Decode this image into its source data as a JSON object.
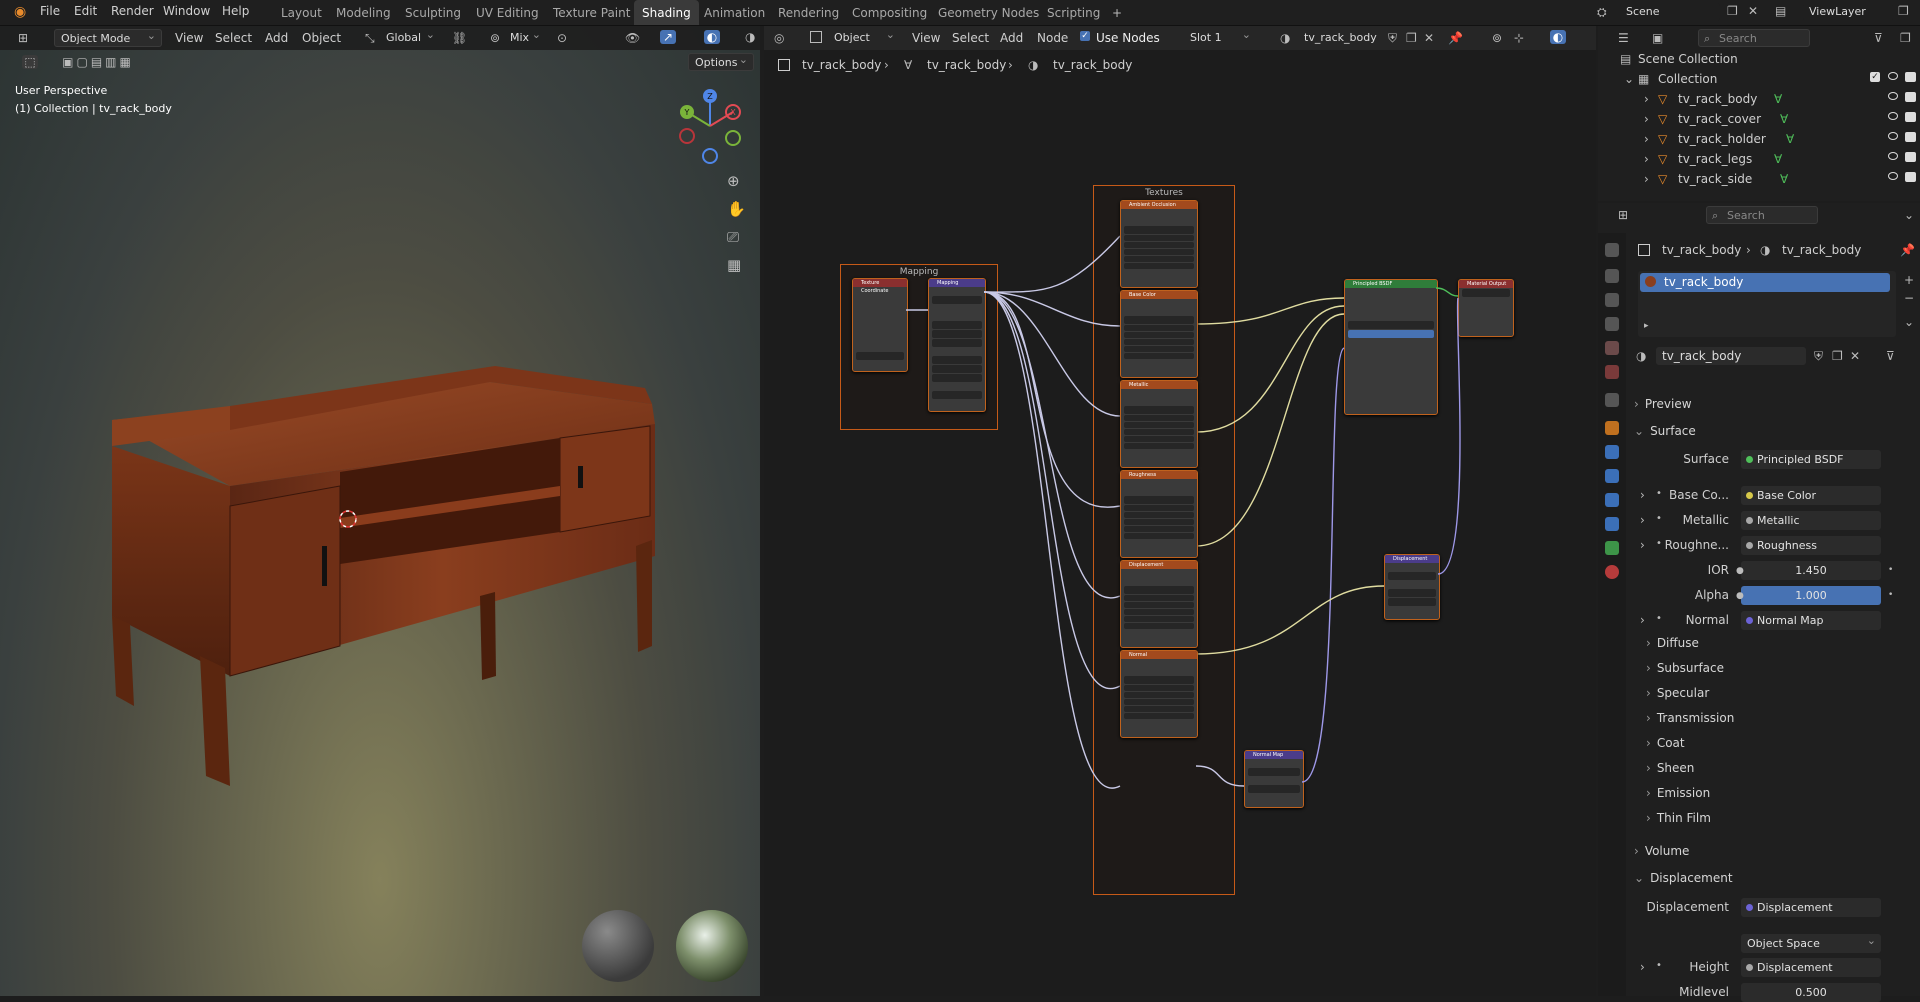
{
  "topbar": {
    "menus": [
      "File",
      "Edit",
      "Render",
      "Window",
      "Help"
    ],
    "workspaces": [
      "Layout",
      "Modeling",
      "Sculpting",
      "UV Editing",
      "Texture Paint",
      "Shading",
      "Animation",
      "Rendering",
      "Compositing",
      "Geometry Nodes",
      "Scripting"
    ],
    "active_workspace": "Shading",
    "add_tab": "+",
    "scene": "Scene",
    "view_layer": "ViewLayer"
  },
  "viewport": {
    "mode": "Object Mode",
    "menus": [
      "View",
      "Select",
      "Add",
      "Object"
    ],
    "orientation": "Global",
    "snap_mix": "Mix",
    "options": "Options",
    "overlay_title": "User Perspective",
    "overlay_collection": "(1) Collection | tv_rack_body",
    "gizmo_axes": {
      "z": "Z",
      "y": "Y",
      "x": "X"
    }
  },
  "node_editor": {
    "type": "Object",
    "menus": [
      "View",
      "Select",
      "Add",
      "Node"
    ],
    "use_nodes": "Use Nodes",
    "slot": "Slot 1",
    "material": "tv_rack_body",
    "breadcrumb": [
      "tv_rack_body",
      "tv_rack_body",
      "tv_rack_body"
    ],
    "frames": {
      "mapping": "Mapping",
      "textures": "Textures"
    },
    "nodes": {
      "tex_coord": "Texture Coordinate",
      "mapping": "Mapping",
      "ambient_occlusion": "Ambient Occlusion",
      "base_color": "Base Color",
      "metallic": "Metallic",
      "roughness": "Roughness",
      "displacement": "Displacement",
      "normal": "Normal",
      "normal_map": "Normal Map",
      "principled": "Principled BSDF",
      "displacement_node": "Displacement",
      "material_output": "Material Output"
    }
  },
  "outliner": {
    "search_placeholder": "Search",
    "scene_collection": "Scene Collection",
    "collection": "Collection",
    "objects": [
      "tv_rack_body",
      "tv_rack_cover",
      "tv_rack_holder",
      "tv_rack_legs",
      "tv_rack_side"
    ]
  },
  "properties": {
    "search_placeholder": "Search",
    "breadcrumb": [
      "tv_rack_body",
      "tv_rack_body"
    ],
    "slot_item": "tv_rack_body",
    "material_name": "tv_rack_body",
    "sections": {
      "preview": "Preview",
      "surface": "Surface",
      "volume": "Volume",
      "displacement": "Displacement"
    },
    "surface_rows": [
      {
        "label": "Surface",
        "value": "Principled BSDF",
        "dot": "#4fbf5a"
      },
      {
        "label": "Base Co...",
        "value": "Base Color",
        "dot": "#d6c84a"
      },
      {
        "label": "Metallic",
        "value": "Metallic",
        "dot": "#a8a8a8"
      },
      {
        "label": "Roughne...",
        "value": "Roughness",
        "dot": "#a8a8a8"
      },
      {
        "label": "IOR",
        "value": "1.450",
        "dot": "#a8a8a8"
      },
      {
        "label": "Alpha",
        "value": "1.000",
        "dot": "#a8a8a8"
      },
      {
        "label": "Normal",
        "value": "Normal Map",
        "dot": "#6c63d6"
      }
    ],
    "subpanels": [
      "Diffuse",
      "Subsurface",
      "Specular",
      "Transmission",
      "Coat",
      "Sheen",
      "Emission",
      "Thin Film"
    ],
    "displacement_rows": [
      {
        "label": "Displacement",
        "value": "Displacement",
        "dot": "#6c63d6"
      },
      {
        "label": "",
        "value": "Object Space",
        "dot": ""
      },
      {
        "label": "Height",
        "value": "Displacement",
        "dot": "#a8a8a8"
      },
      {
        "label": "Midlevel",
        "value": "0.500",
        "dot": "#a8a8a8"
      }
    ]
  }
}
